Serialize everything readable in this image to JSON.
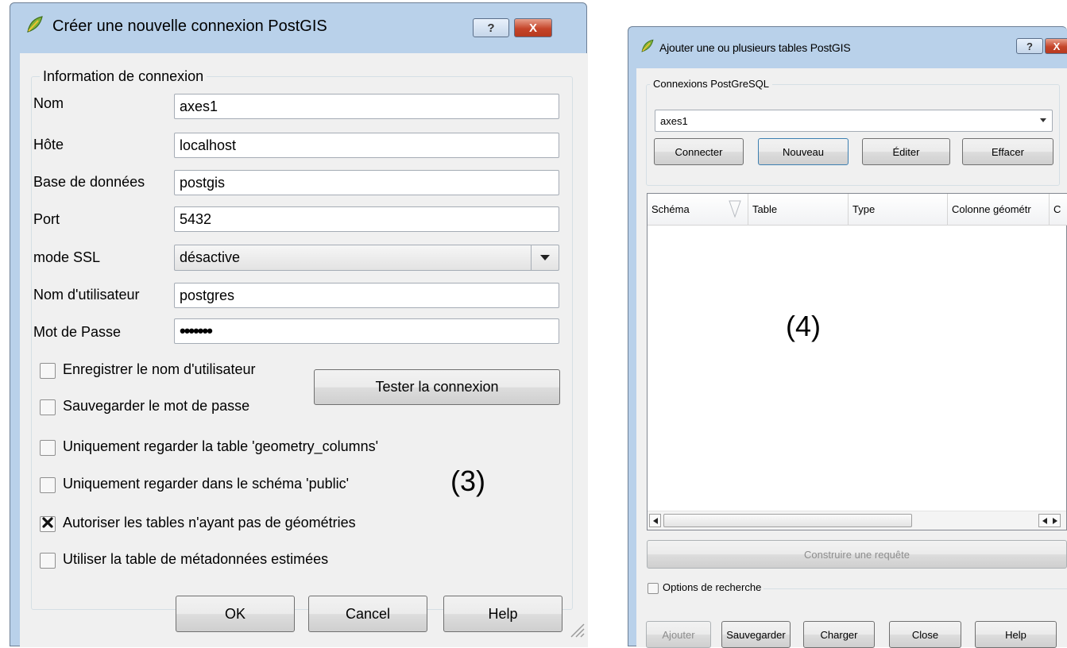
{
  "dialog3": {
    "title": "Créer une nouvelle connexion PostGIS",
    "help_btn": "?",
    "close_btn": "X",
    "group_title": "Information de connexion",
    "fields": [
      {
        "label": "Nom",
        "value": "axes1"
      },
      {
        "label": "Hôte",
        "value": "localhost"
      },
      {
        "label": "Base de données",
        "value": "postgis"
      },
      {
        "label": "Port",
        "value": "5432"
      }
    ],
    "ssl": {
      "label": "mode SSL",
      "value": "désactive"
    },
    "user": {
      "label": "Nom d'utilisateur",
      "value": "postgres"
    },
    "password": {
      "label": "Mot de Passe",
      "value": "•••••••"
    },
    "checkboxes": [
      {
        "label": "Enregistrer le nom d'utilisateur",
        "checked": false
      },
      {
        "label": "Sauvegarder le mot de passe",
        "checked": false
      },
      {
        "label": "Uniquement regarder la table 'geometry_columns'",
        "checked": false
      },
      {
        "label": "Uniquement regarder dans le schéma 'public'",
        "checked": false
      },
      {
        "label": "Autoriser les tables n'ayant pas de géométries",
        "checked": true
      },
      {
        "label": "Utiliser la table de métadonnées estimées",
        "checked": false
      }
    ],
    "test_btn": "Tester la connexion",
    "ok_btn": "OK",
    "cancel_btn": "Cancel",
    "help_footer_btn": "Help",
    "annotation": "(3)"
  },
  "dialog4": {
    "title": "Ajouter une ou plusieurs tables PostGIS",
    "help_btn": "?",
    "close_btn": "X",
    "group_title": "Connexions PostGreSQL",
    "connection_value": "axes1",
    "buttons": {
      "connect": "Connecter",
      "new": "Nouveau",
      "edit": "Éditer",
      "delete": "Effacer"
    },
    "columns": [
      "Schéma",
      "Table",
      "Type",
      "Colonne géométr",
      "C"
    ],
    "annotation": "(4)",
    "build_query": "Construire une requête",
    "search_options": "Options de recherche",
    "footer": {
      "add": "Ajouter",
      "save": "Sauvegarder",
      "load": "Charger",
      "close": "Close",
      "help": "Help"
    }
  },
  "colors": {
    "titlebar": "#b9d1ea",
    "dialog_bg": "#f0f0f0",
    "close_red": "#c5452a"
  },
  "icons": [
    "qgis-logo-icon",
    "help-icon",
    "close-icon",
    "chevron-down-icon",
    "sort-icon",
    "scroll-left-icon",
    "scroll-right-icon",
    "check-mark-icon"
  ]
}
